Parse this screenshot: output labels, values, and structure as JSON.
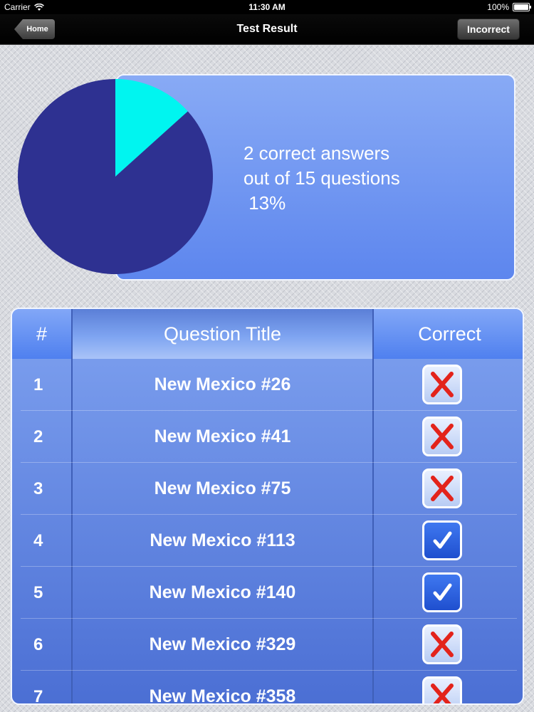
{
  "status_bar": {
    "carrier": "Carrier",
    "time": "11:30 AM",
    "battery": "100%"
  },
  "nav": {
    "back_label": "Home",
    "title": "Test Result",
    "right_label": "Incorrect"
  },
  "summary": {
    "text": "2 correct answers\nout of 15 questions\n 13%"
  },
  "chart_data": {
    "type": "pie",
    "slices": [
      {
        "label": "Correct",
        "value": 2,
        "color": "#00f5f0"
      },
      {
        "label": "Incorrect",
        "value": 13,
        "color": "#2e3191"
      }
    ]
  },
  "table": {
    "headers": {
      "num": "#",
      "title": "Question Title",
      "correct": "Correct"
    },
    "rows": [
      {
        "num": "1",
        "title": "New Mexico #26",
        "correct": false
      },
      {
        "num": "2",
        "title": "New Mexico #41",
        "correct": false
      },
      {
        "num": "3",
        "title": "New Mexico #75",
        "correct": false
      },
      {
        "num": "4",
        "title": "New Mexico #113",
        "correct": true
      },
      {
        "num": "5",
        "title": "New Mexico #140",
        "correct": true
      },
      {
        "num": "6",
        "title": "New Mexico #329",
        "correct": false
      },
      {
        "num": "7",
        "title": "New Mexico #358",
        "correct": false
      }
    ]
  },
  "colors": {
    "cross": "#e3231b",
    "check": "#ffffff"
  }
}
